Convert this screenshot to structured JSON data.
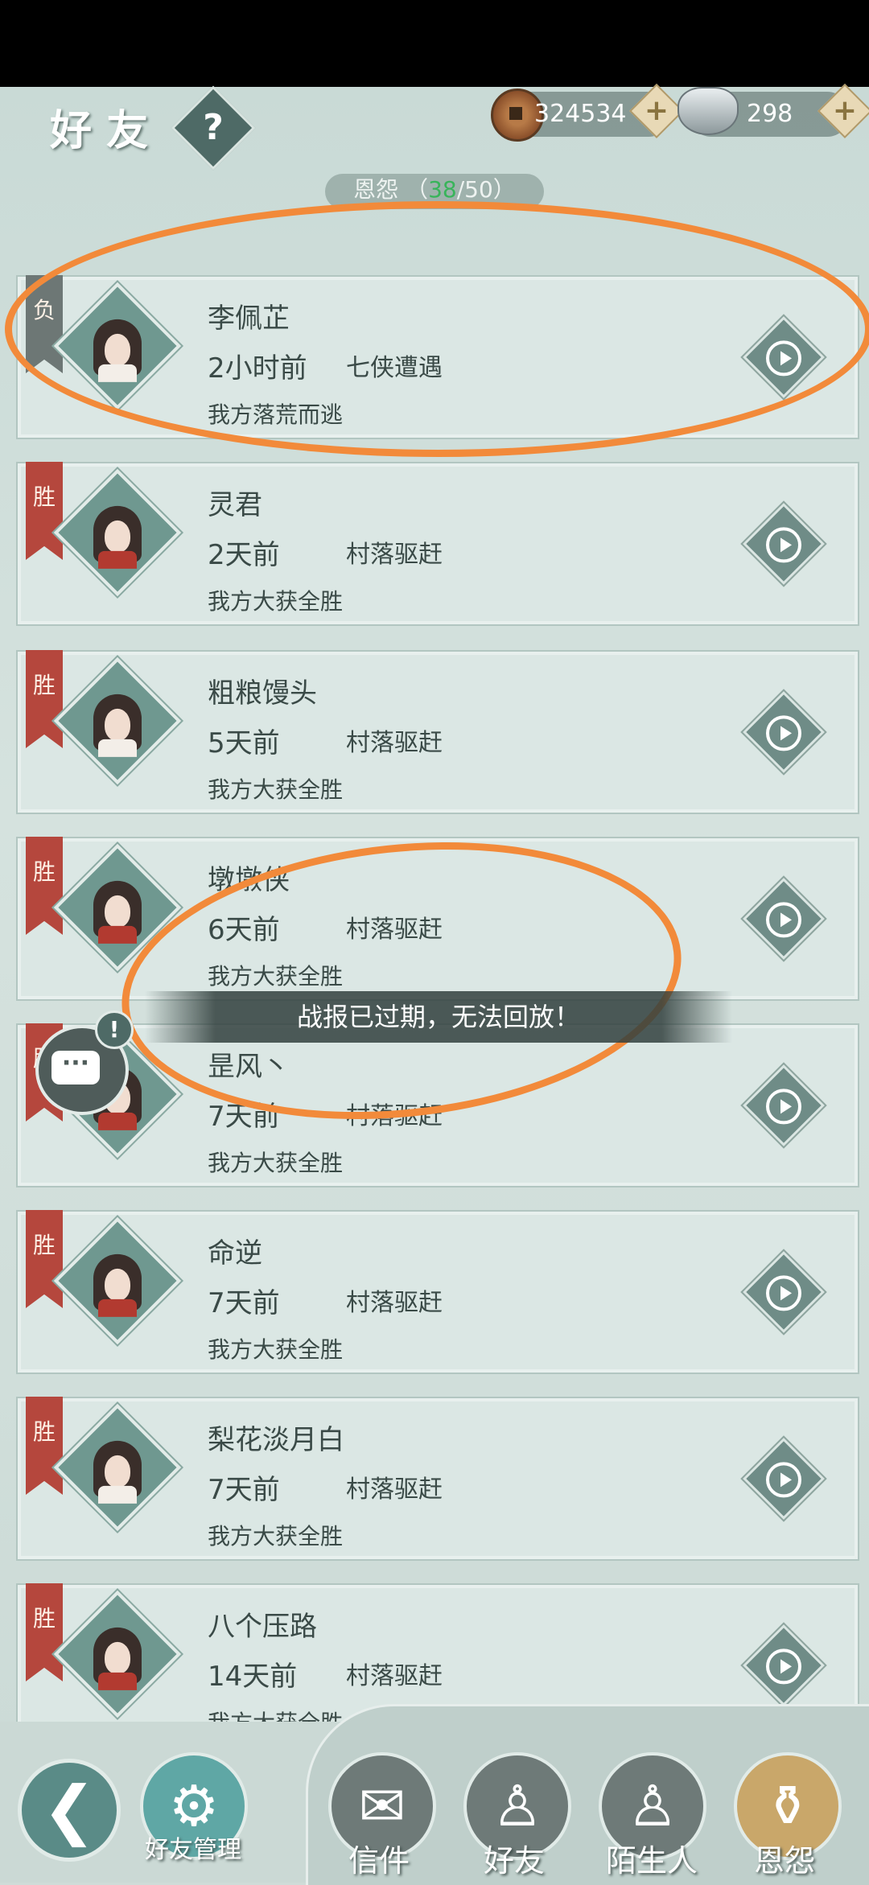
{
  "header": {
    "title": "好友",
    "help_label": "?",
    "coins": "324534",
    "silver": "298",
    "plus_label": "+"
  },
  "tab": {
    "label": "恩怨",
    "count_current": "38",
    "count_total": "/50"
  },
  "records": [
    {
      "badge": "负",
      "name": "李佩芷",
      "time": "2小时前",
      "mode": "七侠遭遇",
      "result": "我方落荒而逃"
    },
    {
      "badge": "胜",
      "name": "灵君",
      "time": "2天前",
      "mode": "村落驱赶",
      "result": "我方大获全胜"
    },
    {
      "badge": "胜",
      "name": "粗粮馒头",
      "time": "5天前",
      "mode": "村落驱赶",
      "result": "我方大获全胜"
    },
    {
      "badge": "胜",
      "name": "墩墩侠",
      "time": "6天前",
      "mode": "村落驱赶",
      "result": "我方大获全胜"
    },
    {
      "badge": "胜",
      "name": "昰风丶",
      "time": "7天前",
      "mode": "村落驱赶",
      "result": "我方大获全胜"
    },
    {
      "badge": "胜",
      "name": "命逆",
      "time": "7天前",
      "mode": "村落驱赶",
      "result": "我方大获全胜"
    },
    {
      "badge": "胜",
      "name": "梨花淡月白",
      "time": "7天前",
      "mode": "村落驱赶",
      "result": "我方大获全胜"
    },
    {
      "badge": "胜",
      "name": "八个压路",
      "time": "14天前",
      "mode": "村落驱赶",
      "result": "我方大获全胜"
    }
  ],
  "toast": "战报已过期，无法回放！",
  "bottom": {
    "back": "❮",
    "friend_manage": "好友管理",
    "mail": "信件",
    "friends": "好友",
    "strangers": "陌生人",
    "grudges": "恩怨"
  },
  "colors": {
    "annotation": "#f28a3a",
    "win_ribbon": "#b5473d",
    "lose_ribbon": "#6d7775",
    "count_highlight": "#38b45a"
  }
}
